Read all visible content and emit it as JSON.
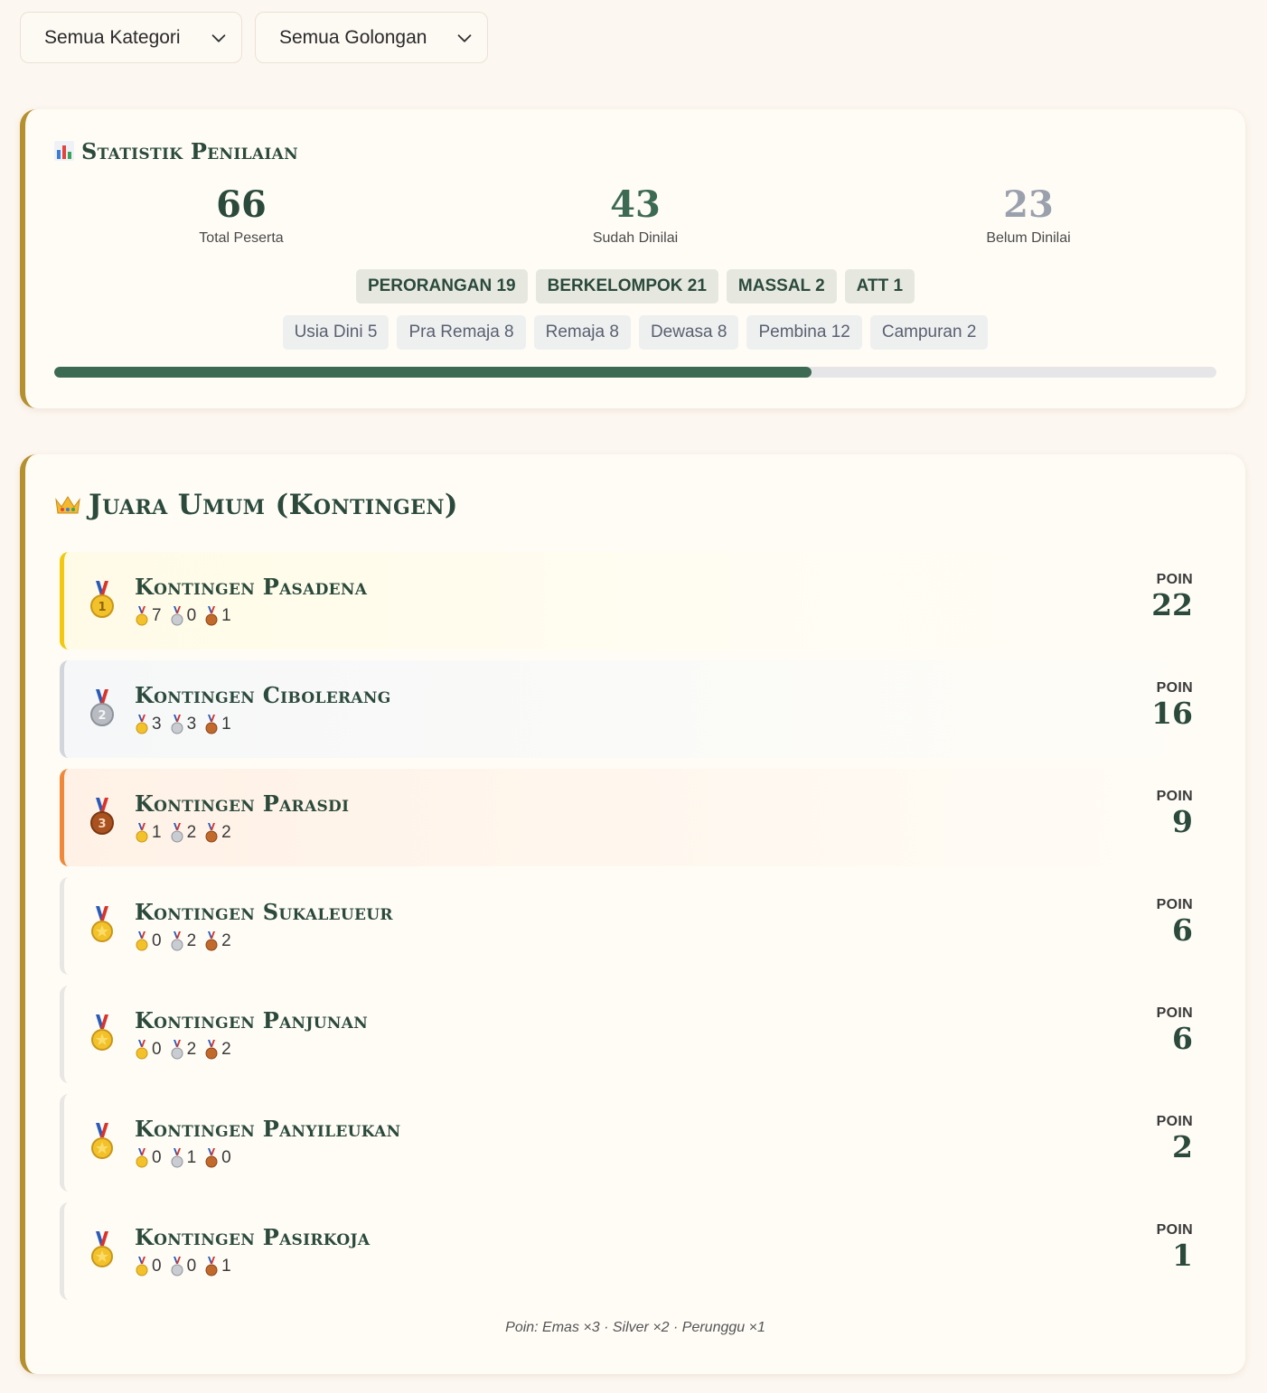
{
  "filters": {
    "kategori": "Semua Kategori",
    "golongan": "Semua Golongan"
  },
  "stats": {
    "icon": "bar-chart-icon",
    "title": "Statistik Penilaian",
    "total": {
      "value": "66",
      "label": "Total Peserta"
    },
    "sudah": {
      "value": "43",
      "label": "Sudah Dinilai"
    },
    "belum": {
      "value": "23",
      "label": "Belum Dinilai"
    },
    "kategori_chips": [
      "PERORANGAN 19",
      "BERKELOMPOK 21",
      "MASSAL 2",
      "ATT 1"
    ],
    "golongan_chips": [
      "Usia Dini 5",
      "Pra Remaja 8",
      "Remaja 8",
      "Dewasa 8",
      "Pembina 12",
      "Campuran 2"
    ],
    "progress_fraction": 0.652,
    "colors": {
      "accent": "#3d6a53",
      "muted_number": "#9aa1ac",
      "border_gold": "#b5902f"
    }
  },
  "ranking": {
    "icon": "crown-icon",
    "title": "Juara Umum (Kontingen)",
    "points_label": "POIN",
    "rows": [
      {
        "rank_icon": "gold-medal-1-icon",
        "name": "Kontingen Pasadena",
        "gold": "7",
        "silver": "0",
        "bronze": "1",
        "points": "22"
      },
      {
        "rank_icon": "silver-medal-2-icon",
        "name": "Kontingen Cibolerang",
        "gold": "3",
        "silver": "3",
        "bronze": "1",
        "points": "16"
      },
      {
        "rank_icon": "bronze-medal-3-icon",
        "name": "Kontingen Parasdi",
        "gold": "1",
        "silver": "2",
        "bronze": "2",
        "points": "9"
      },
      {
        "rank_icon": "sports-medal-icon",
        "name": "Kontingen Sukaleueur",
        "gold": "0",
        "silver": "2",
        "bronze": "2",
        "points": "6"
      },
      {
        "rank_icon": "sports-medal-icon",
        "name": "Kontingen Panjunan",
        "gold": "0",
        "silver": "2",
        "bronze": "2",
        "points": "6"
      },
      {
        "rank_icon": "sports-medal-icon",
        "name": "Kontingen Panyileukan",
        "gold": "0",
        "silver": "1",
        "bronze": "0",
        "points": "2"
      },
      {
        "rank_icon": "sports-medal-icon",
        "name": "Kontingen Pasirkoja",
        "gold": "0",
        "silver": "0",
        "bronze": "1",
        "points": "1"
      }
    ],
    "footnote": "Poin: Emas ×3 · Silver ×2 · Perunggu ×1"
  }
}
